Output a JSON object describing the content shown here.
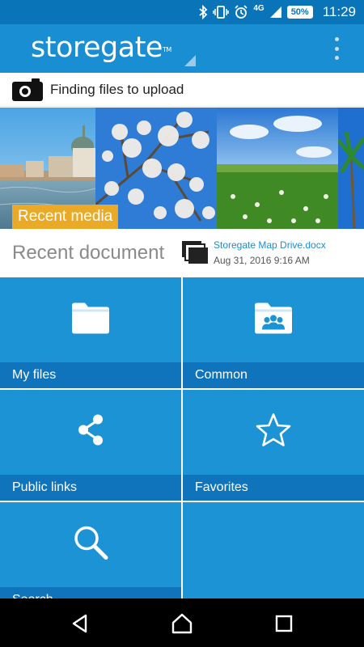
{
  "status_bar": {
    "network": "4G",
    "battery": "50%",
    "time": "11:29",
    "icons": [
      "bluetooth-icon",
      "vibrate-icon",
      "alarm-icon",
      "signal-icon",
      "battery-icon"
    ]
  },
  "app_bar": {
    "logo": "storegate",
    "logo_tm": "TM",
    "menu_icon": "overflow-menu-icon"
  },
  "upload_status": {
    "icon": "camera-icon",
    "text": "Finding files to upload"
  },
  "recent_media": {
    "label": "Recent media"
  },
  "recent_document": {
    "title": "Recent document",
    "icon": "documents-stack-icon",
    "file_name": "Storegate Map Drive.docx",
    "date": "Aug 31, 2016 9:16 AM"
  },
  "tiles": [
    {
      "label": "My files",
      "icon": "folder-icon"
    },
    {
      "label": "Common",
      "icon": "shared-folder-icon"
    },
    {
      "label": "Public links",
      "icon": "share-icon"
    },
    {
      "label": "Favorites",
      "icon": "star-icon"
    },
    {
      "label": "Search",
      "icon": "search-icon"
    }
  ],
  "colors": {
    "status_bar": "#0a74b9",
    "app_bar": "#1a8ed3",
    "tile": "#1b93d5",
    "tile_label": "#0f74bc",
    "accent": "#eaaa28"
  }
}
